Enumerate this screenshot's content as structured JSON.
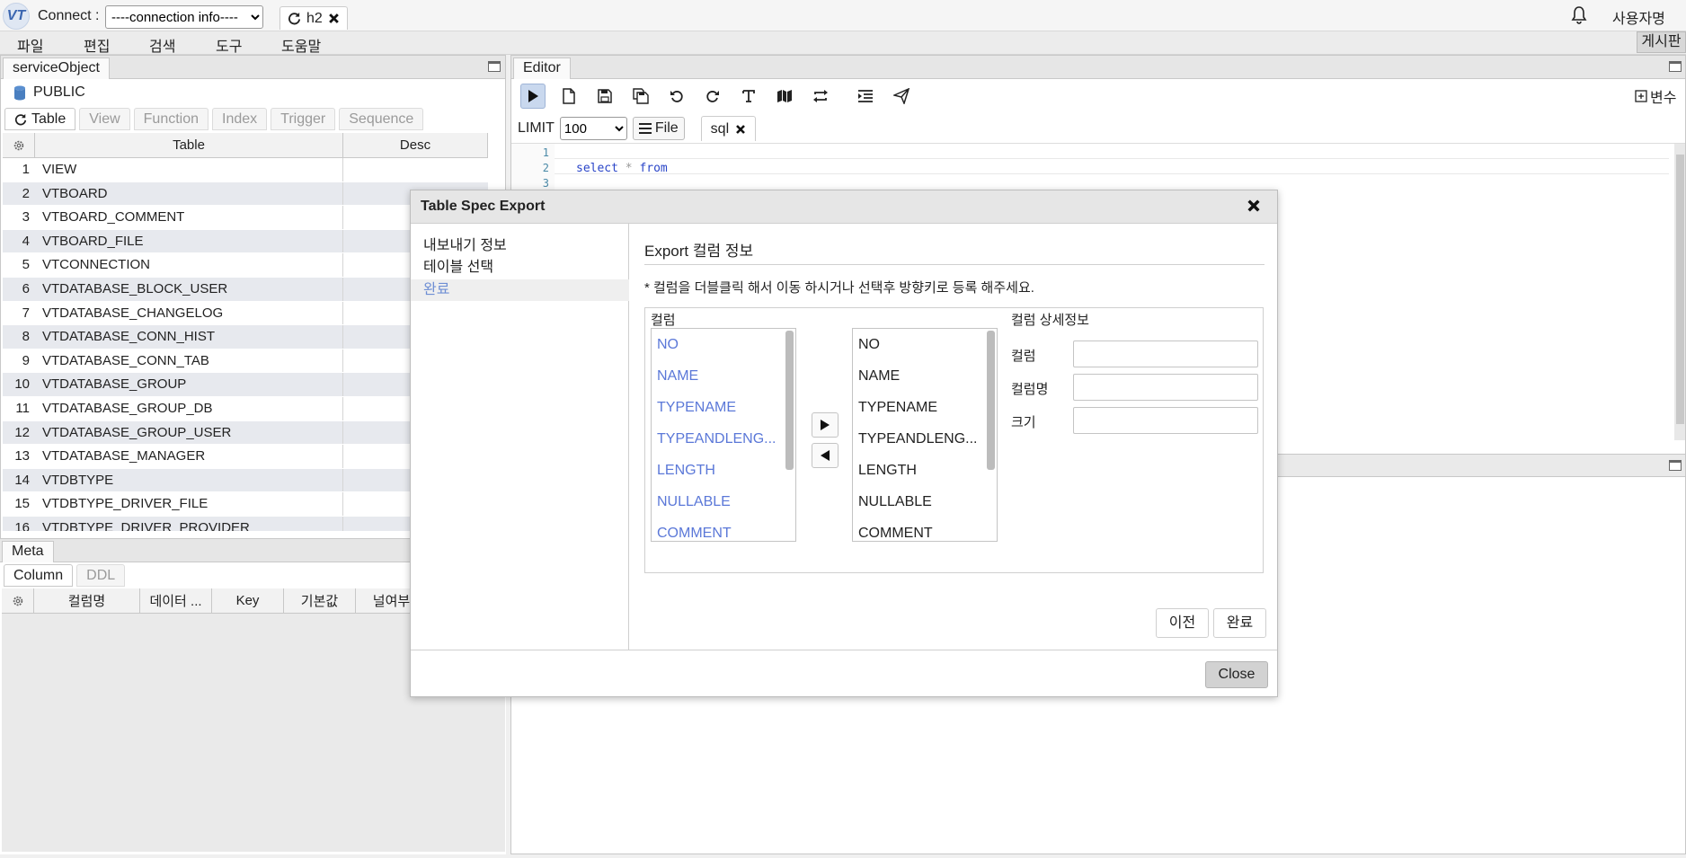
{
  "app": {
    "logo_text": "VT"
  },
  "topbar": {
    "connect_label": "Connect :",
    "connection_selected": "----connection info----",
    "db_tab_label": "h2",
    "user_name": "사용자명"
  },
  "menu": {
    "items": [
      "파일",
      "편집",
      "검색",
      "도구",
      "도움말"
    ],
    "board_button": "게시판"
  },
  "left_panel": {
    "title": "serviceObject",
    "schema": "PUBLIC",
    "tabs": [
      "Table",
      "View",
      "Function",
      "Index",
      "Trigger",
      "Sequence"
    ],
    "grid_headers": [
      "Table",
      "Desc"
    ],
    "rows": [
      {
        "no": "1",
        "name": "VIEW"
      },
      {
        "no": "2",
        "name": "VTBOARD"
      },
      {
        "no": "3",
        "name": "VTBOARD_COMMENT"
      },
      {
        "no": "4",
        "name": "VTBOARD_FILE"
      },
      {
        "no": "5",
        "name": "VTCONNECTION"
      },
      {
        "no": "6",
        "name": "VTDATABASE_BLOCK_USER"
      },
      {
        "no": "7",
        "name": "VTDATABASE_CHANGELOG"
      },
      {
        "no": "8",
        "name": "VTDATABASE_CONN_HIST"
      },
      {
        "no": "9",
        "name": "VTDATABASE_CONN_TAB"
      },
      {
        "no": "10",
        "name": "VTDATABASE_GROUP"
      },
      {
        "no": "11",
        "name": "VTDATABASE_GROUP_DB"
      },
      {
        "no": "12",
        "name": "VTDATABASE_GROUP_USER"
      },
      {
        "no": "13",
        "name": "VTDATABASE_MANAGER"
      },
      {
        "no": "14",
        "name": "VTDBTYPE"
      },
      {
        "no": "15",
        "name": "VTDBTYPE_DRIVER_FILE"
      },
      {
        "no": "16",
        "name": "VTDBTYPE_DRIVER_PROVIDER"
      }
    ]
  },
  "meta_panel": {
    "title": "Meta",
    "tabs": [
      "Column",
      "DDL"
    ],
    "headers": [
      "컬럼명",
      "데이터 ...",
      "Key",
      "기본값",
      "널여부"
    ]
  },
  "editor": {
    "title": "Editor",
    "var_button": "변수",
    "limit_label": "LIMIT",
    "limit_value": "100",
    "file_button": "File",
    "sql_tab": "sql",
    "lines": [
      {
        "no": "1",
        "text": ""
      },
      {
        "no": "2",
        "text": "select * from"
      },
      {
        "no": "3",
        "text": ""
      }
    ]
  },
  "dialog": {
    "title": "Table Spec Export",
    "steps": [
      "내보내기 정보",
      "테이블 선택",
      "완료"
    ],
    "active_step": "완료",
    "section_title": "Export 컬럼 정보",
    "hint": "* 컬럼을 더블클릭 해서 이동 하시거나 선택후 방향키로 등록 해주세요.",
    "column_label": "컬럼",
    "source_columns": [
      "NO",
      "NAME",
      "TYPENAME",
      "TYPEANDLENG...",
      "LENGTH",
      "NULLABLE",
      "COMMENT"
    ],
    "target_columns": [
      "NO",
      "NAME",
      "TYPENAME",
      "TYPEANDLENG...",
      "LENGTH",
      "NULLABLE",
      "COMMENT"
    ],
    "detail": {
      "title": "컬럼 상세정보",
      "column_label": "컬럼",
      "name_label": "컬럼명",
      "size_label": "크기",
      "column_value": "",
      "name_value": "",
      "size_value": ""
    },
    "prev_button": "이전",
    "finish_button": "완료",
    "close_button": "Close"
  },
  "colors": {
    "accent_blue": "#5b78d8",
    "active_step": "#6f8fd4",
    "row_alt": "#e7e9ee"
  }
}
